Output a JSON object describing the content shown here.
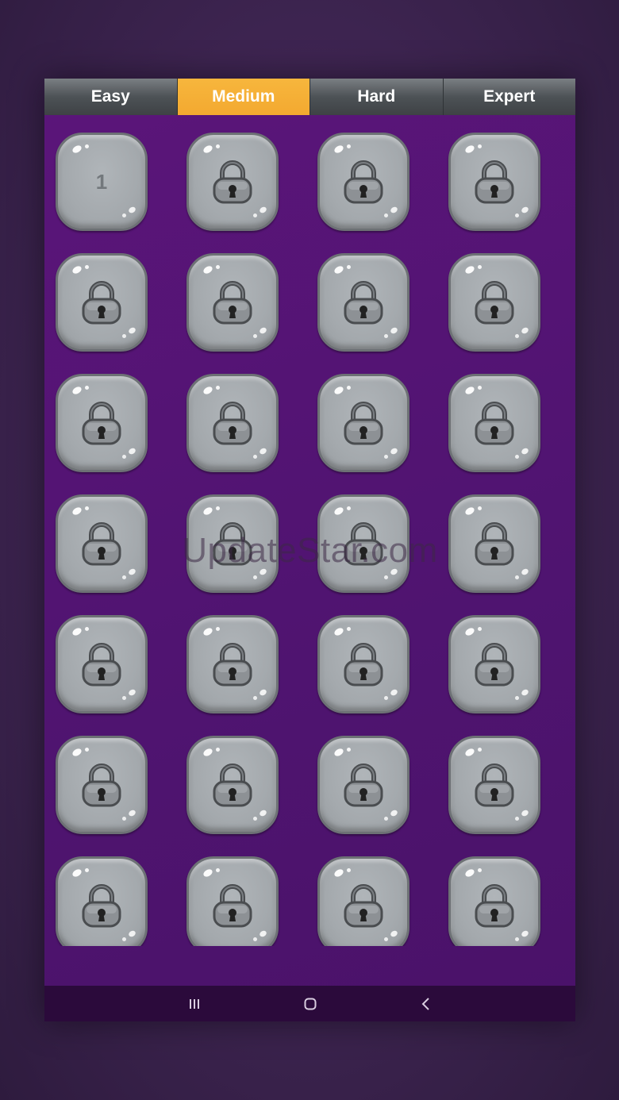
{
  "tabs": [
    {
      "label": "Easy",
      "active": false
    },
    {
      "label": "Medium",
      "active": true
    },
    {
      "label": "Hard",
      "active": false
    },
    {
      "label": "Expert",
      "active": false
    }
  ],
  "levels": [
    {
      "number": "1",
      "locked": false
    },
    {
      "locked": true
    },
    {
      "locked": true
    },
    {
      "locked": true
    },
    {
      "locked": true
    },
    {
      "locked": true
    },
    {
      "locked": true
    },
    {
      "locked": true
    },
    {
      "locked": true
    },
    {
      "locked": true
    },
    {
      "locked": true
    },
    {
      "locked": true
    },
    {
      "locked": true
    },
    {
      "locked": true
    },
    {
      "locked": true
    },
    {
      "locked": true
    },
    {
      "locked": true
    },
    {
      "locked": true
    },
    {
      "locked": true
    },
    {
      "locked": true
    },
    {
      "locked": true
    },
    {
      "locked": true
    },
    {
      "locked": true
    },
    {
      "locked": true
    },
    {
      "locked": true
    },
    {
      "locked": true
    },
    {
      "locked": true
    },
    {
      "locked": true
    }
  ],
  "icons": {
    "lock": "padlock-icon",
    "recents": "recents-icon",
    "home": "home-icon",
    "back": "back-icon"
  },
  "watermark": "UpdateStar.com",
  "colors": {
    "accent": "#f3a930",
    "background": "#4f1470",
    "navbar": "#2b0a3b"
  }
}
